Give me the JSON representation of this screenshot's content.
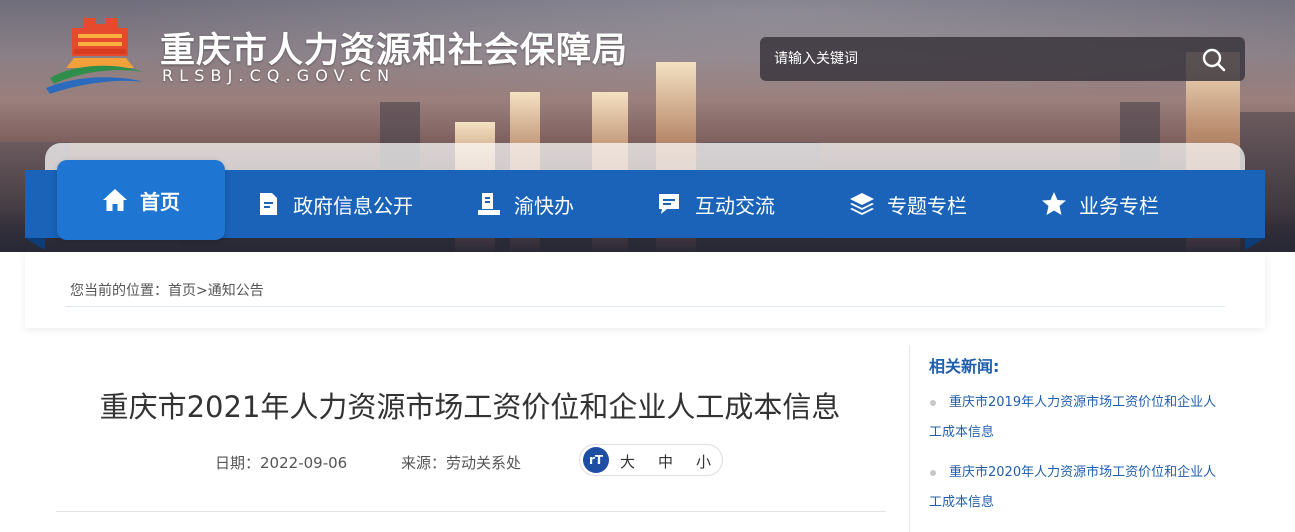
{
  "header": {
    "site_title": "重庆市人力资源和社会保障局",
    "site_domain": "RLSBJ.CQ.GOV.CN",
    "logo_icon": "government-building-logo",
    "search": {
      "placeholder": "请输入关键词",
      "button_icon": "search-icon"
    }
  },
  "nav": {
    "items": [
      {
        "label": "首页",
        "icon": "home-icon",
        "active": true
      },
      {
        "label": "政府信息公开",
        "icon": "document-icon"
      },
      {
        "label": "渝快办",
        "icon": "service-desk-icon"
      },
      {
        "label": "互动交流",
        "icon": "chat-icon"
      },
      {
        "label": "专题专栏",
        "icon": "layers-icon"
      },
      {
        "label": "业务专栏",
        "icon": "star-icon"
      }
    ],
    "colors": {
      "bar": "#1a63b8",
      "active": "#1f75d2"
    }
  },
  "breadcrumb": {
    "prefix": "您当前的位置：",
    "items": [
      "首页",
      "通知公告"
    ],
    "separator": ">"
  },
  "article": {
    "title": "重庆市2021年人力资源市场工资价位和企业人工成本信息",
    "date_label": "日期：",
    "date": "2022-09-06",
    "source_label": "来源：",
    "source": "劳动关系处",
    "font_size": {
      "icon_text": "rT",
      "large": "大",
      "medium": "中",
      "small": "小"
    }
  },
  "sidebar": {
    "title": "相关新闻:",
    "items": [
      {
        "line1": "重庆市2019年人力资源市场工资价位和企业人",
        "line2": "工成本信息"
      },
      {
        "line1": "重庆市2020年人力资源市场工资价位和企业人",
        "line2": "工成本信息"
      }
    ],
    "link_color": "#1f5fae"
  }
}
